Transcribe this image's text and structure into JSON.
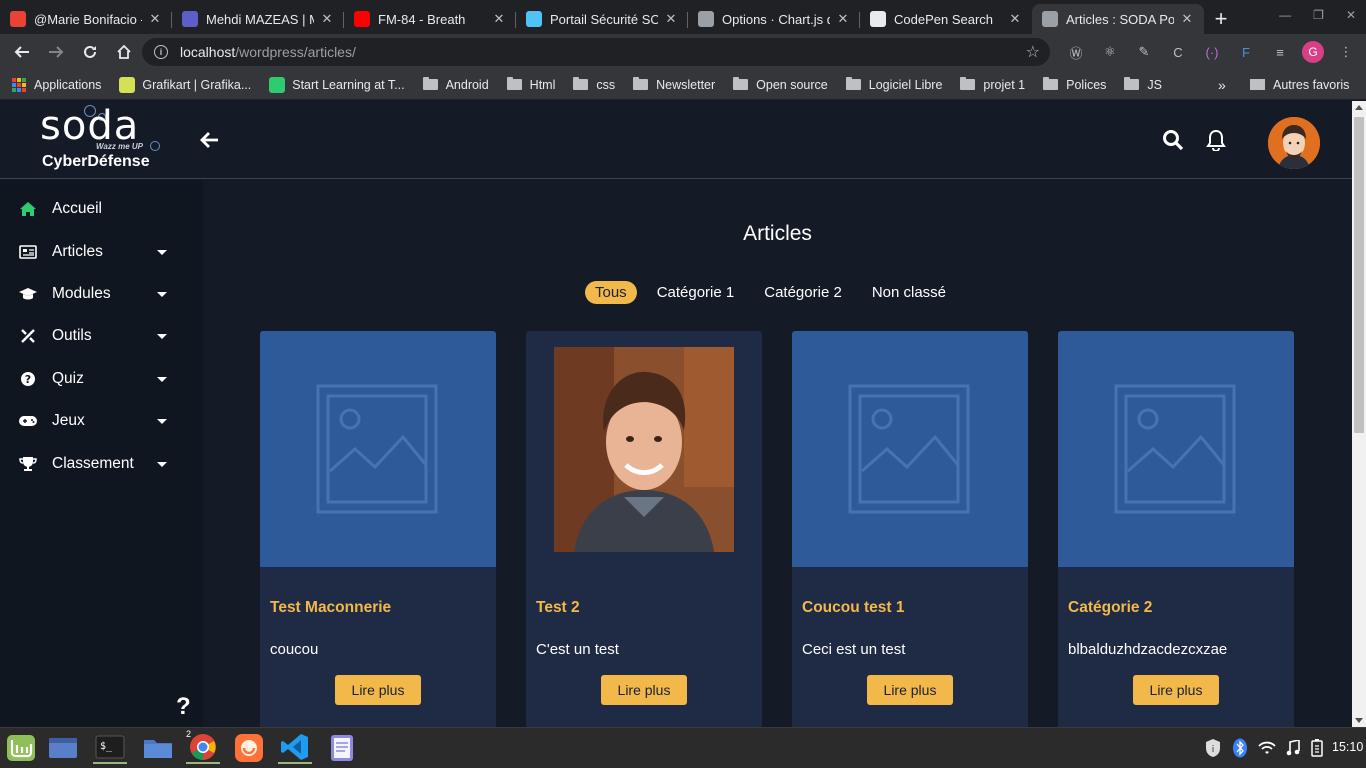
{
  "browser": {
    "tabs": [
      {
        "title": "@Marie Bonifacio -",
        "favicon_color": "#ea4335"
      },
      {
        "title": "Mehdi MAZEAS | M",
        "favicon_color": "#5b5fc7"
      },
      {
        "title": "FM-84 - Breath",
        "favicon_color": "#ff0000"
      },
      {
        "title": "Portail Sécurité SO",
        "favicon_color": "#4fc3f7"
      },
      {
        "title": "Options · Chart.js d",
        "favicon_color": "#9aa0a6"
      },
      {
        "title": "CodePen Search",
        "favicon_color": "#e8eaed"
      },
      {
        "title": "Articles : SODA Por",
        "favicon_color": "#9aa0a6"
      }
    ],
    "close_glyph": "✕",
    "new_tab": "+",
    "url_host": "localhost",
    "url_path": "/wordpress/articles/",
    "profile_initial": "G",
    "bookmarks": [
      {
        "label": "Applications",
        "type": "apps"
      },
      {
        "label": "Grafikart | Grafika...",
        "type": "site",
        "color": "#d4e157"
      },
      {
        "label": "Start Learning at T...",
        "type": "site",
        "color": "#2ecc71"
      },
      {
        "label": "Android",
        "type": "folder"
      },
      {
        "label": "Html",
        "type": "folder"
      },
      {
        "label": "css",
        "type": "folder"
      },
      {
        "label": "Newsletter",
        "type": "folder"
      },
      {
        "label": "Open source",
        "type": "folder"
      },
      {
        "label": "Logiciel Libre",
        "type": "folder"
      },
      {
        "label": "projet 1",
        "type": "folder"
      },
      {
        "label": "Polices",
        "type": "folder"
      },
      {
        "label": "JS",
        "type": "folder"
      }
    ],
    "bookmarks_more": "»",
    "other_bookmarks": "Autres favoris"
  },
  "site": {
    "logo": {
      "name": "soda",
      "tagline": "Wazz me UP",
      "subtitle": "CyberDéfense"
    },
    "nav": [
      {
        "label": "Accueil",
        "icon": "home-icon",
        "caret": false
      },
      {
        "label": "Articles",
        "icon": "newspaper-icon",
        "caret": true
      },
      {
        "label": "Modules",
        "icon": "graduation-cap-icon",
        "caret": true
      },
      {
        "label": "Outils",
        "icon": "tools-icon",
        "caret": true
      },
      {
        "label": "Quiz",
        "icon": "question-circle-icon",
        "caret": true
      },
      {
        "label": "Jeux",
        "icon": "gamepad-icon",
        "caret": true
      },
      {
        "label": "Classement",
        "icon": "trophy-icon",
        "caret": true
      }
    ],
    "help": "?",
    "page_title": "Articles",
    "filters": [
      {
        "label": "Tous",
        "active": true
      },
      {
        "label": "Catégorie 1",
        "active": false
      },
      {
        "label": "Catégorie 2",
        "active": false
      },
      {
        "label": "Non classé",
        "active": false
      }
    ],
    "cards": [
      {
        "title": "Test Maconnerie",
        "excerpt": "coucou",
        "button": "Lire plus",
        "image": "placeholder"
      },
      {
        "title": "Test 2",
        "excerpt": "C'est un test",
        "button": "Lire plus",
        "image": "photo"
      },
      {
        "title": "Coucou test 1",
        "excerpt": "Ceci est un test",
        "button": "Lire plus",
        "image": "placeholder"
      },
      {
        "title": "Catégorie 2",
        "excerpt": "blbalduzhdzacdezcxzae",
        "button": "Lire plus",
        "image": "placeholder"
      }
    ],
    "accent_color": "#f2b94a"
  },
  "taskbar": {
    "chrome_badge": "2",
    "clock": "15:10"
  }
}
